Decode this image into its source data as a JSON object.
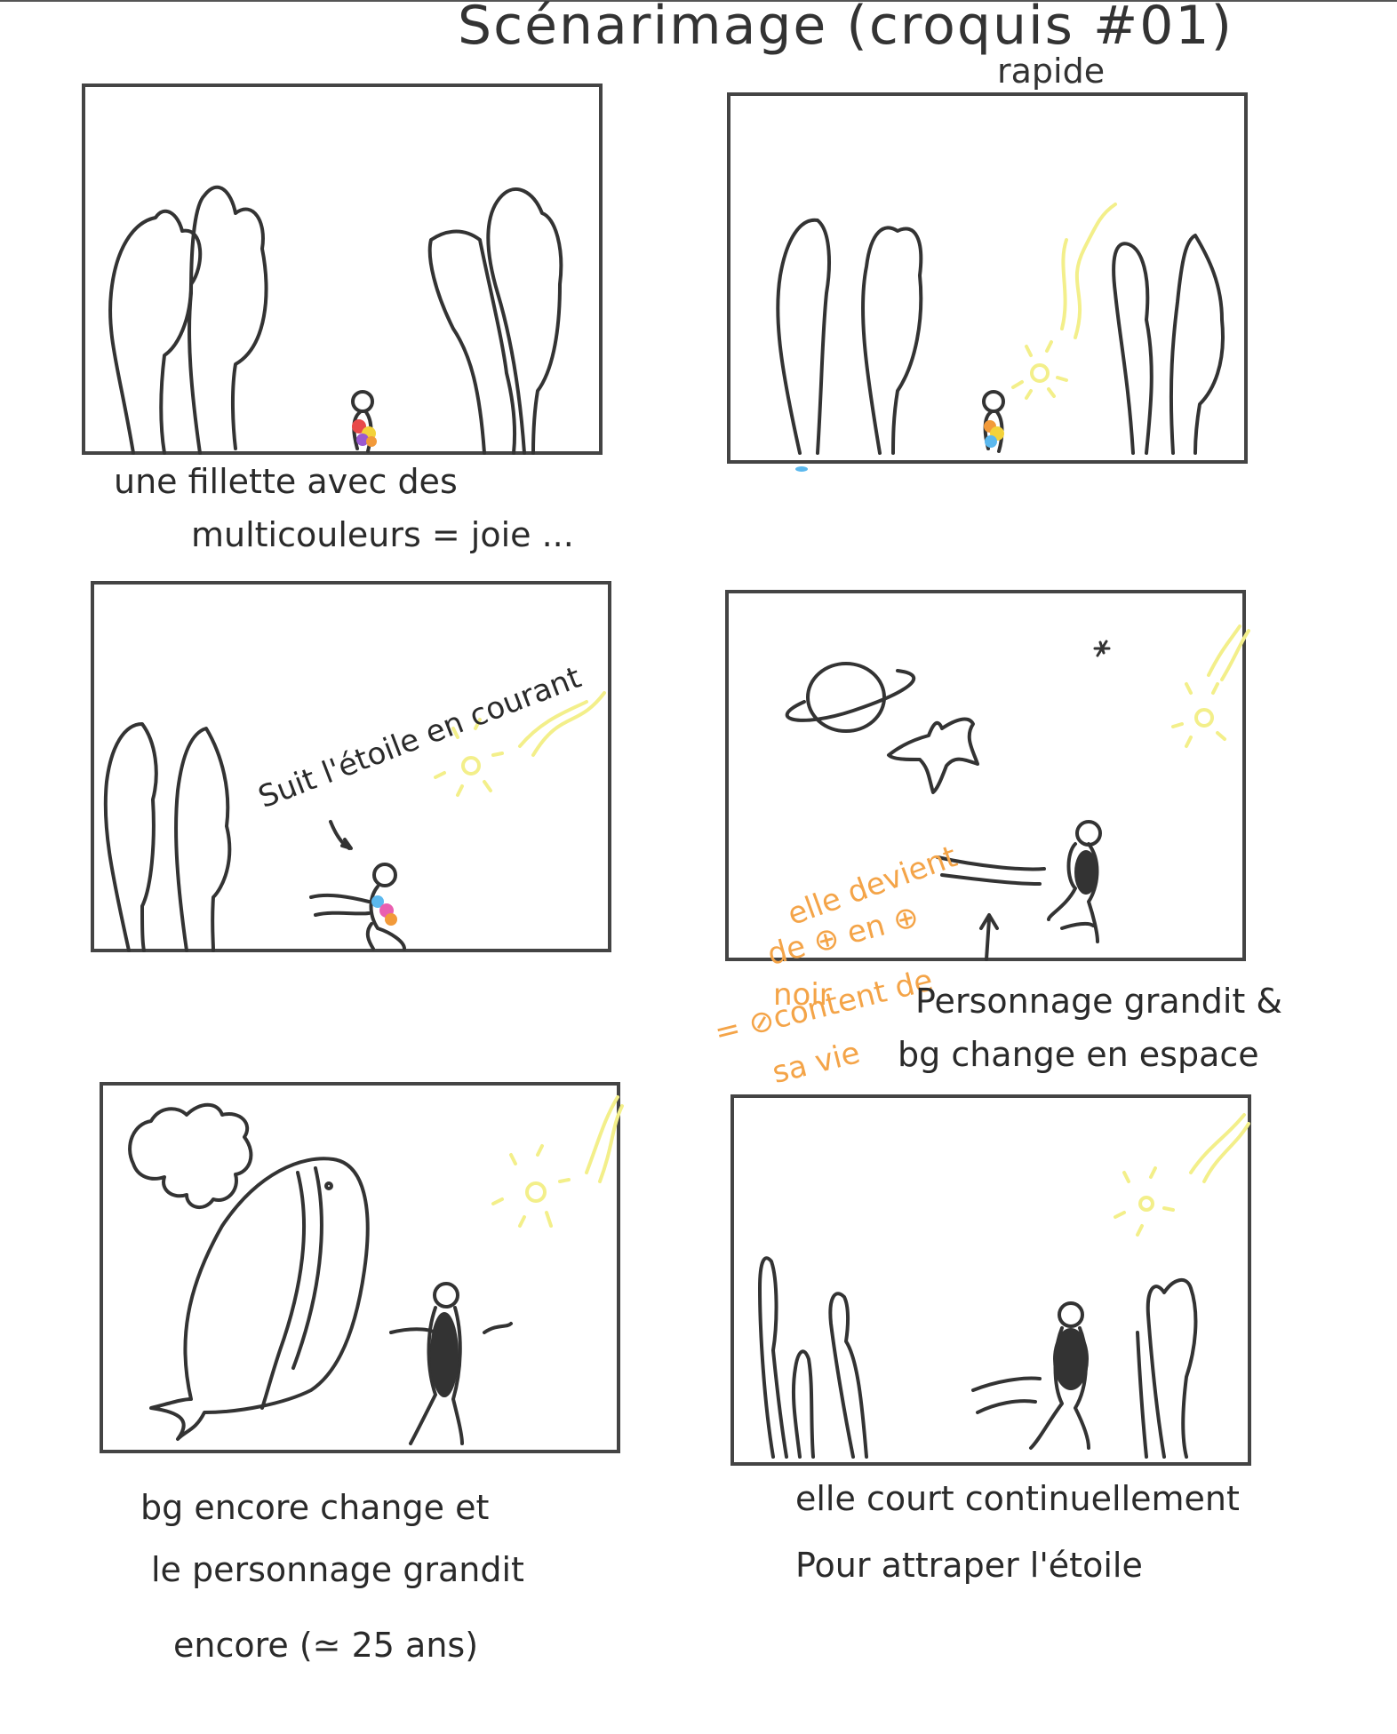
{
  "title": "Scénarimage (croquis #01)",
  "subtitle": "rapide",
  "panels": [
    {
      "caption_1": "une fillette avec des",
      "caption_2": "multicouleurs = joie ..."
    },
    {
      "caption_1": ""
    },
    {
      "annotation": "Suit l'étoile en courant"
    },
    {
      "annotation_1": "elle devient",
      "annotation_2": "de ⊕ en ⊕",
      "annotation_3": "noir",
      "annotation_4": "= ⊘content de",
      "annotation_5": "sa vie",
      "caption_1": "Personnage grandit &",
      "caption_2": "bg change en espace"
    },
    {
      "caption_1": "bg encore change et",
      "caption_2": "le personnage grandit",
      "caption_3": "encore (≃ 25 ans)"
    },
    {
      "caption_1": "elle court continuellement",
      "caption_2": "Pour attraper l'étoile"
    }
  ],
  "colors": {
    "ink": "#333333",
    "sun": "#f3ef8a",
    "annotation": "#f4a448",
    "frame": "#444444"
  }
}
